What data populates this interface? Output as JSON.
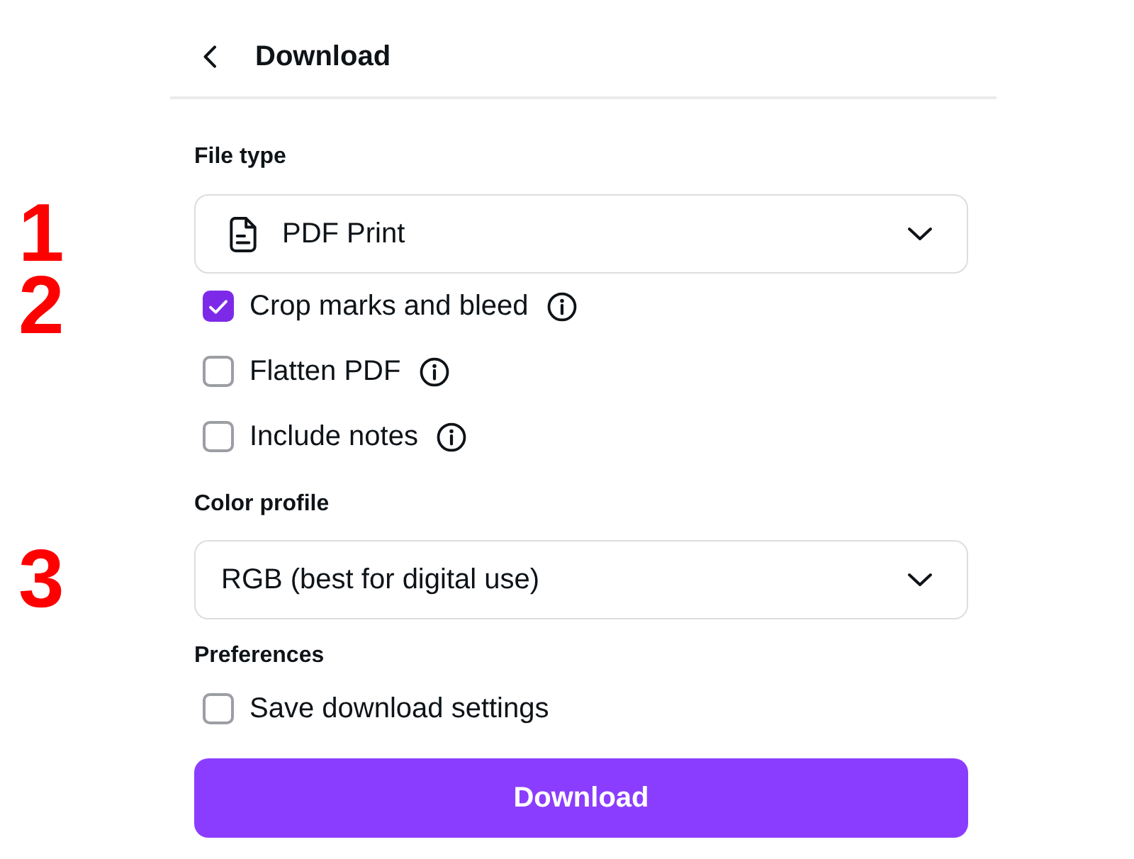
{
  "header": {
    "title": "Download"
  },
  "file_type": {
    "label": "File type",
    "dropdown": {
      "value": "PDF Print",
      "file_icon": true,
      "marker": "1"
    }
  },
  "options": [
    {
      "label": "Crop marks and bleed",
      "checked": true,
      "info": true,
      "marker": "2"
    },
    {
      "label": "Flatten PDF",
      "checked": false,
      "info": true
    },
    {
      "label": "Include notes",
      "checked": false,
      "info": true
    }
  ],
  "color_profile": {
    "label": "Color profile",
    "dropdown": {
      "value": "RGB (best for digital use)",
      "file_icon": false,
      "marker": "3"
    }
  },
  "preferences": {
    "label": "Preferences",
    "options": [
      {
        "label": "Save download settings",
        "checked": false,
        "info": false
      }
    ]
  },
  "download_button": {
    "label": "Download"
  }
}
